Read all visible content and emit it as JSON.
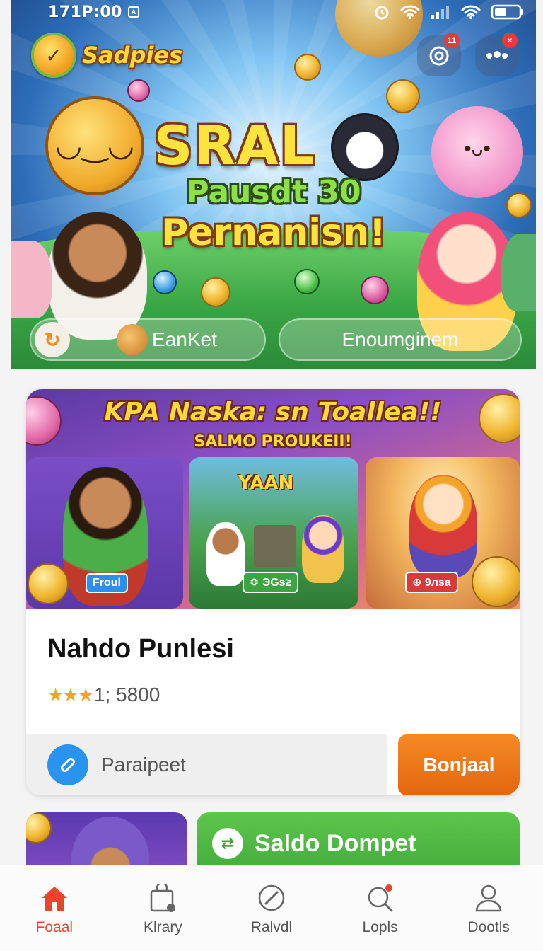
{
  "status_bar": {
    "time": "171P:00",
    "carrier_icon": "app-notification-icon"
  },
  "header": {
    "logo_text": "Sadpies",
    "notification_badge": "11",
    "message_badge": "×"
  },
  "hero": {
    "title_line1": "SRAL",
    "title_line2": "Pausdt  30",
    "title_line3": "Pernanisn!",
    "pill_left_label": "EanKet",
    "pill_right_label": "Enoumginem"
  },
  "game_card": {
    "banner_title": "KPA Naska: sn Toallea!!",
    "banner_subtitle": "SALMO PROUKEII!",
    "panel_logo": "YAAN",
    "panel_tags": [
      "Froul",
      "≎ ЭGs≥",
      "⊕ 9лsa"
    ],
    "name": "Nahdo Punlesi",
    "stars": "★★★",
    "rating_text": "1; 5800",
    "share_label": "Paraipeet",
    "cta_label": "Bonjaal"
  },
  "wallet": {
    "label": "Saldo Dompet"
  },
  "bottom_nav": [
    {
      "label": "Foaal",
      "icon": "home-icon",
      "active": true
    },
    {
      "label": "Klrary",
      "icon": "bag-icon",
      "active": false
    },
    {
      "label": "Ralvdl",
      "icon": "compass-icon",
      "active": false
    },
    {
      "label": "Lopls",
      "icon": "search-icon",
      "active": false
    },
    {
      "label": "Dootls",
      "icon": "profile-icon",
      "active": false
    }
  ],
  "colors": {
    "accent": "#e8462a",
    "cta": "#f07a1a",
    "wallet": "#4cb842",
    "share": "#2a93ee"
  }
}
